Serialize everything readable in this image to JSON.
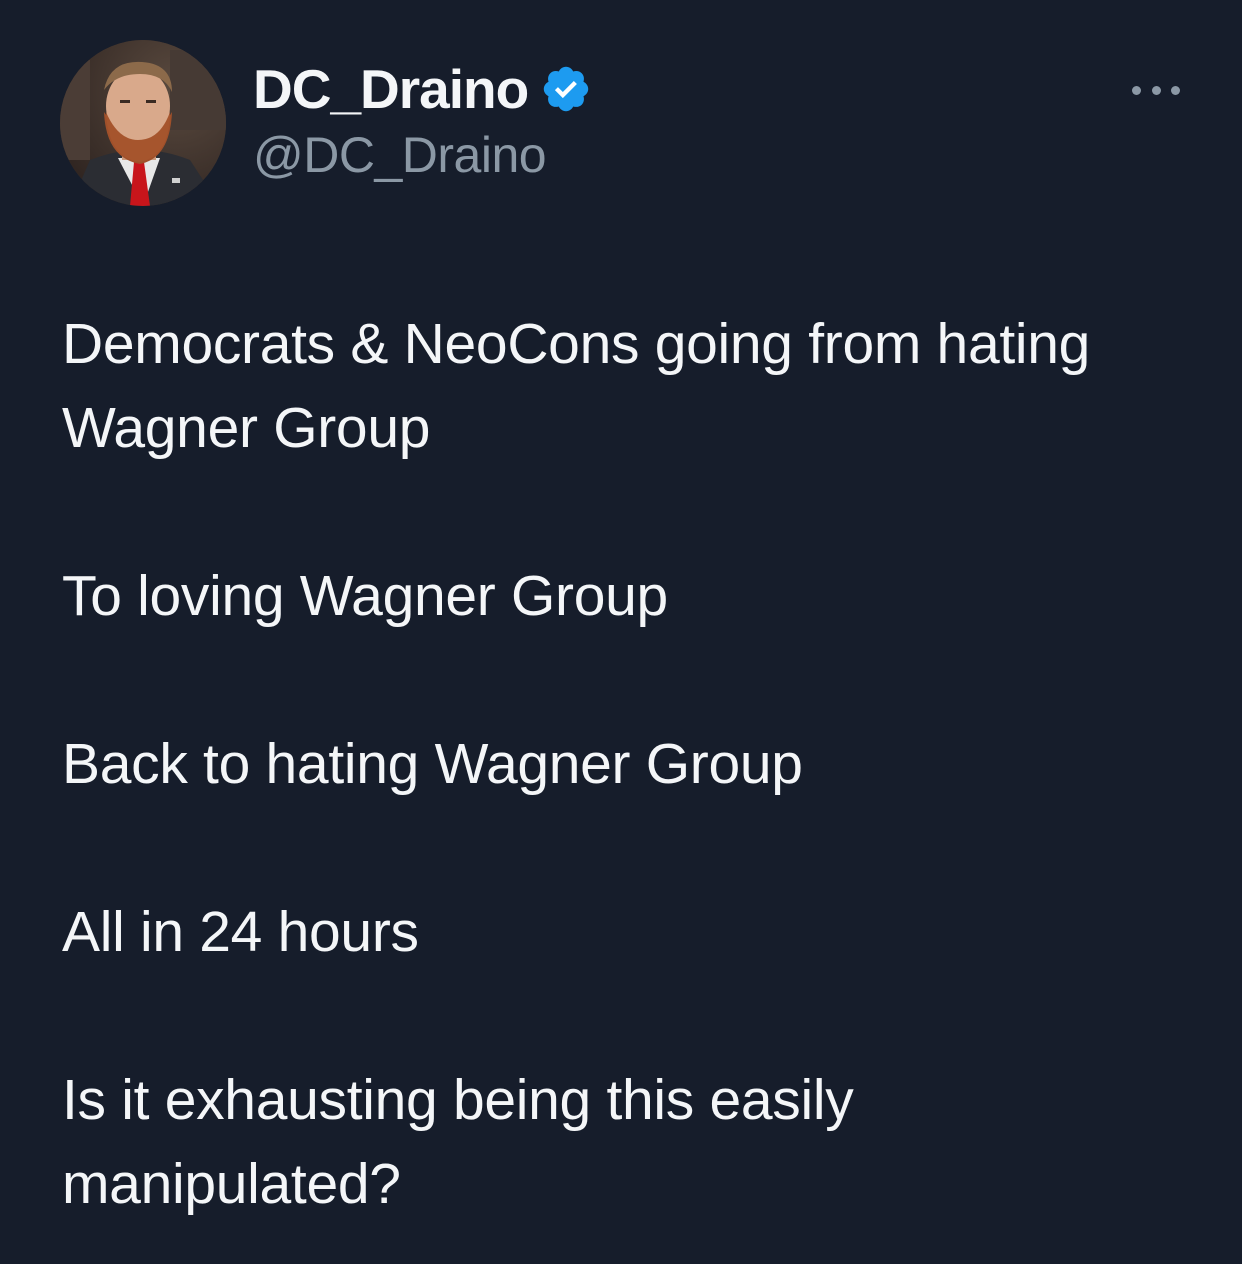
{
  "author": {
    "display_name": "DC_Draino",
    "handle": "@DC_Draino",
    "verified": true,
    "verified_color": "#1d9bf0"
  },
  "menu": {
    "icon": "more-horizontal-icon"
  },
  "tweet": {
    "paragraphs": [
      "Democrats & NeoCons going from hating Wagner Group",
      "To loving Wagner Group",
      "Back to hating Wagner Group",
      "All in 24 hours",
      "Is it exhausting being this easily manipulated?"
    ]
  },
  "colors": {
    "background": "#161d2b",
    "text": "#f4f6f8",
    "secondary_text": "#8b98a5"
  }
}
